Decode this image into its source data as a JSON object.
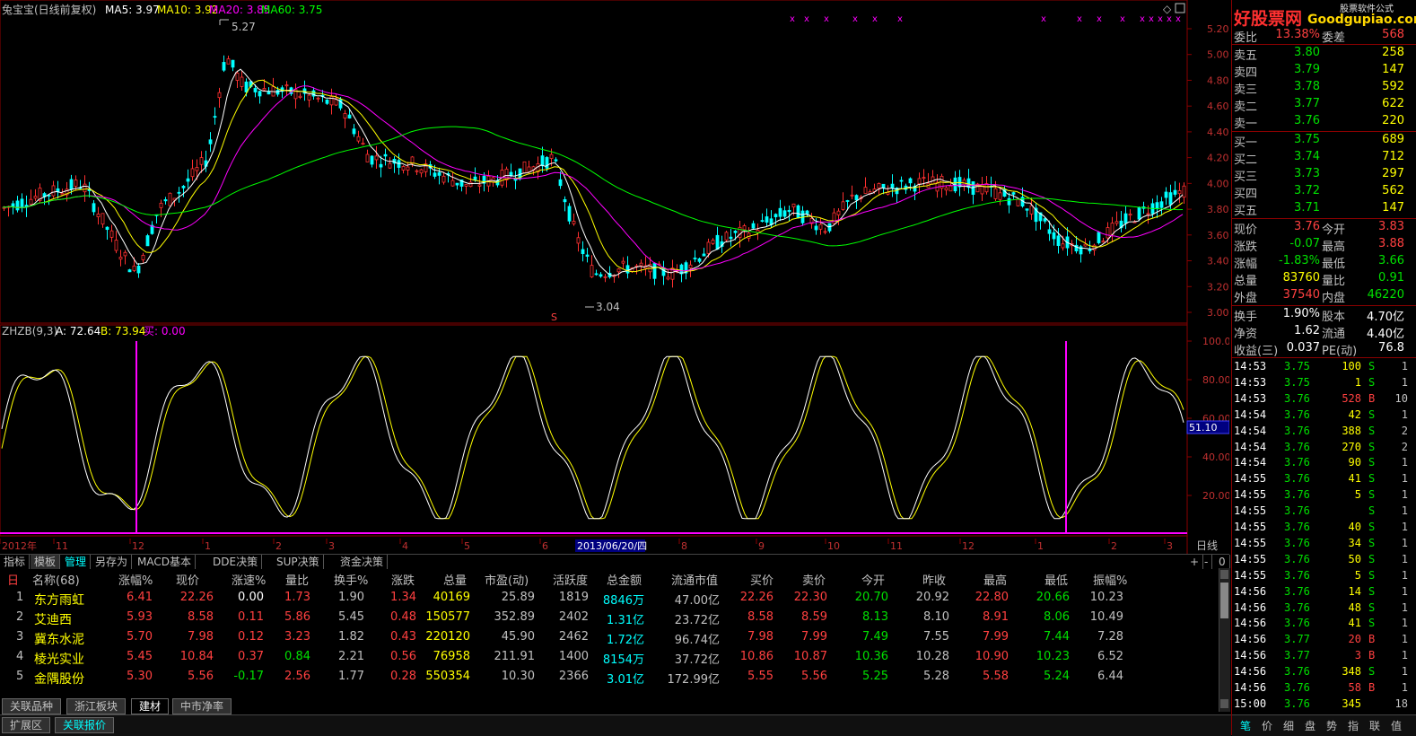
{
  "main_chart": {
    "stock": "兔宝宝(日线前复权)",
    "ma": [
      {
        "label": "MA5: 3.97",
        "color": "#ffffff"
      },
      {
        "label": "MA10: 3.92",
        "color": "#ffff00"
      },
      {
        "label": "MA20: 3.85",
        "color": "#ff00ff"
      },
      {
        "label": "MA60: 3.75",
        "color": "#00ff00"
      }
    ],
    "y_ticks": [
      "5.20",
      "5.00",
      "4.80",
      "4.60",
      "4.40",
      "4.20",
      "4.00",
      "3.80",
      "3.60",
      "3.40",
      "3.20",
      "3.00"
    ],
    "ylim": [
      3.0,
      5.2
    ],
    "high_label": "5.27",
    "low_label": "3.04",
    "s_marker": "S"
  },
  "indicator": {
    "title": "ZHZB(9,3)",
    "a_label": "A: 72.64",
    "b_label": "B: 73.94",
    "buy_label": "买: 0.00",
    "y_ticks": [
      "100.0",
      "80.00",
      "60.00",
      "40.00",
      "20.00"
    ],
    "current_value": "51.10"
  },
  "date_axis": {
    "labels": [
      "2012年",
      "11",
      "12",
      "1",
      "2",
      "3",
      "4",
      "5",
      "6",
      "7",
      "8",
      "9",
      "10",
      "11",
      "12",
      "1",
      "2",
      "3"
    ],
    "highlight": "2013/06/20/四",
    "period": "日线"
  },
  "tabs": [
    "指标",
    "模板",
    "管理",
    "另存为",
    "MACD基本",
    "DDE决策",
    "SUP决策",
    "资金决策"
  ],
  "tab_controls": [
    "+",
    "-",
    "0"
  ],
  "watermark": {
    "brand": "好股票网",
    "url": "Goodgupiao.com",
    "corner": "股票软件公式"
  },
  "quote": {
    "weibi": {
      "label": "委比",
      "value": "13.38%",
      "label2": "委差",
      "value2": "568"
    },
    "asks": [
      {
        "label": "卖五",
        "price": "3.80",
        "vol": "258"
      },
      {
        "label": "卖四",
        "price": "3.79",
        "vol": "147"
      },
      {
        "label": "卖三",
        "price": "3.78",
        "vol": "592"
      },
      {
        "label": "卖二",
        "price": "3.77",
        "vol": "622"
      },
      {
        "label": "卖一",
        "price": "3.76",
        "vol": "220"
      }
    ],
    "bids": [
      {
        "label": "买一",
        "price": "3.75",
        "vol": "689"
      },
      {
        "label": "买二",
        "price": "3.74",
        "vol": "712"
      },
      {
        "label": "买三",
        "price": "3.73",
        "vol": "297"
      },
      {
        "label": "买四",
        "price": "3.72",
        "vol": "562"
      },
      {
        "label": "买五",
        "price": "3.71",
        "vol": "147"
      }
    ],
    "stats": [
      {
        "l1": "现价",
        "v1": "3.76",
        "c1": "#ff4040",
        "l2": "今开",
        "v2": "3.83",
        "c2": "#ff4040"
      },
      {
        "l1": "涨跌",
        "v1": "-0.07",
        "c1": "#00e000",
        "l2": "最高",
        "v2": "3.88",
        "c2": "#ff4040"
      },
      {
        "l1": "涨幅",
        "v1": "-1.83%",
        "c1": "#00e000",
        "l2": "最低",
        "v2": "3.66",
        "c2": "#00e000"
      },
      {
        "l1": "总量",
        "v1": "83760",
        "c1": "#ffff00",
        "l2": "量比",
        "v2": "0.91",
        "c2": "#00e000"
      },
      {
        "l1": "外盘",
        "v1": "37540",
        "c1": "#ff4040",
        "l2": "内盘",
        "v2": "46220",
        "c2": "#00e000"
      }
    ],
    "stats2": [
      {
        "l1": "换手",
        "v1": "1.90%",
        "l2": "股本",
        "v2": "4.70亿"
      },
      {
        "l1": "净资",
        "v1": "1.62",
        "l2": "流通",
        "v2": "4.40亿"
      },
      {
        "l1": "收益(三)",
        "v1": "0.037",
        "l2": "PE(动)",
        "v2": "76.8"
      }
    ],
    "ticks": [
      {
        "t": "14:53",
        "p": "3.75",
        "v": "100",
        "d": "S",
        "n": "1"
      },
      {
        "t": "14:53",
        "p": "3.75",
        "v": "1",
        "d": "S",
        "n": "1"
      },
      {
        "t": "14:53",
        "p": "3.76",
        "v": "528",
        "d": "B",
        "n": "10"
      },
      {
        "t": "14:54",
        "p": "3.76",
        "v": "42",
        "d": "S",
        "n": "1"
      },
      {
        "t": "14:54",
        "p": "3.76",
        "v": "388",
        "d": "S",
        "n": "2"
      },
      {
        "t": "14:54",
        "p": "3.76",
        "v": "270",
        "d": "S",
        "n": "2"
      },
      {
        "t": "14:54",
        "p": "3.76",
        "v": "90",
        "d": "S",
        "n": "1"
      },
      {
        "t": "14:55",
        "p": "3.76",
        "v": "41",
        "d": "S",
        "n": "1"
      },
      {
        "t": "14:55",
        "p": "3.76",
        "v": "5",
        "d": "S",
        "n": "1"
      },
      {
        "t": "14:55",
        "p": "3.76",
        "v": "",
        "d": "S",
        "n": "1"
      },
      {
        "t": "14:55",
        "p": "3.76",
        "v": "40",
        "d": "S",
        "n": "1"
      },
      {
        "t": "14:55",
        "p": "3.76",
        "v": "34",
        "d": "S",
        "n": "1"
      },
      {
        "t": "14:55",
        "p": "3.76",
        "v": "50",
        "d": "S",
        "n": "1"
      },
      {
        "t": "14:55",
        "p": "3.76",
        "v": "5",
        "d": "S",
        "n": "1"
      },
      {
        "t": "14:56",
        "p": "3.76",
        "v": "14",
        "d": "S",
        "n": "1"
      },
      {
        "t": "14:56",
        "p": "3.76",
        "v": "48",
        "d": "S",
        "n": "1"
      },
      {
        "t": "14:56",
        "p": "3.76",
        "v": "41",
        "d": "S",
        "n": "1"
      },
      {
        "t": "14:56",
        "p": "3.77",
        "v": "20",
        "d": "B",
        "n": "1"
      },
      {
        "t": "14:56",
        "p": "3.77",
        "v": "3",
        "d": "B",
        "n": "1"
      },
      {
        "t": "14:56",
        "p": "3.76",
        "v": "348",
        "d": "S",
        "n": "1"
      },
      {
        "t": "14:56",
        "p": "3.76",
        "v": "58",
        "d": "B",
        "n": "1"
      },
      {
        "t": "15:00",
        "p": "3.76",
        "v": "345",
        "d": "",
        "n": "18"
      }
    ],
    "bottom_tabs": [
      "笔",
      "价",
      "细",
      "盘",
      "势",
      "指",
      "联",
      "值"
    ]
  },
  "table": {
    "headers": [
      "名称(68)",
      "涨幅%",
      "现价",
      "涨速%",
      "量比",
      "换手%",
      "涨跌",
      "总量",
      "市盈(动)",
      "活跃度",
      "总金额",
      "流通市值",
      "买价",
      "卖价",
      "今开",
      "昨收",
      "最高",
      "最低",
      "振幅%"
    ],
    "rows": [
      [
        "1",
        "东方雨虹",
        "6.41",
        "22.26",
        "0.00",
        "1.73",
        "1.90",
        "1.34",
        "40169",
        "25.89",
        "1819",
        "8846万",
        "47.00亿",
        "22.26",
        "22.30",
        "20.70",
        "20.92",
        "22.80",
        "20.66",
        "10.23"
      ],
      [
        "2",
        "艾迪西",
        "5.93",
        "8.58",
        "0.11",
        "5.86",
        "5.45",
        "0.48",
        "150577",
        "352.89",
        "2402",
        "1.31亿",
        "23.72亿",
        "8.58",
        "8.59",
        "8.13",
        "8.10",
        "8.91",
        "8.06",
        "10.49"
      ],
      [
        "3",
        "冀东水泥",
        "5.70",
        "7.98",
        "0.12",
        "3.23",
        "1.82",
        "0.43",
        "220120",
        "45.90",
        "2462",
        "1.72亿",
        "96.74亿",
        "7.98",
        "7.99",
        "7.49",
        "7.55",
        "7.99",
        "7.44",
        "7.28"
      ],
      [
        "4",
        "棱光实业",
        "5.45",
        "10.84",
        "0.37",
        "0.84",
        "2.21",
        "0.56",
        "76958",
        "211.91",
        "1400",
        "8154万",
        "37.72亿",
        "10.86",
        "10.87",
        "10.36",
        "10.28",
        "10.90",
        "10.23",
        "6.52"
      ],
      [
        "5",
        "金隅股份",
        "5.30",
        "5.56",
        "-0.17",
        "2.56",
        "1.77",
        "0.28",
        "550354",
        "10.30",
        "2366",
        "3.01亿",
        "172.99亿",
        "5.55",
        "5.56",
        "5.25",
        "5.28",
        "5.58",
        "5.24",
        "6.44"
      ]
    ]
  },
  "sector_tabs": [
    "关联品种",
    "浙江板块",
    "建材",
    "中市净率"
  ],
  "status_tabs": [
    "扩展区",
    "关联报价"
  ],
  "colors": {
    "up": "#ff4040",
    "down": "#00e000",
    "grid": "#8b0000",
    "label": "#c0c0c0",
    "volume": "#ffff00",
    "amount": "#00ffff"
  }
}
